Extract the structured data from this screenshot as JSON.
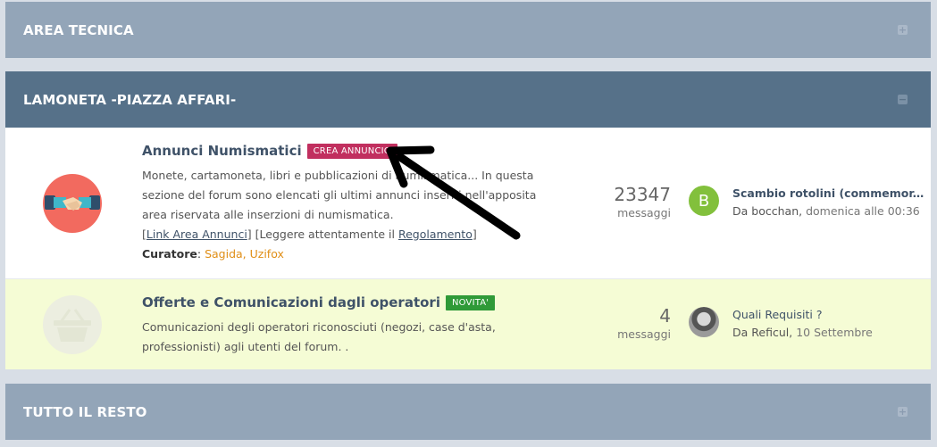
{
  "categories": [
    {
      "title": "AREA TECNICA",
      "state": "collapsed"
    },
    {
      "title": "LAMONETA -PIAZZA AFFARI-",
      "state": "expanded"
    },
    {
      "title": "TUTTO IL RESTO",
      "state": "collapsed"
    }
  ],
  "forums": [
    {
      "title": "Annunci Numismatici",
      "badge": "CREA ANNUNCIO",
      "badge_color": "#c12f5f",
      "desc_line1": "Monete, cartamoneta, libri e pubblicazioni di numismatica... In questa",
      "desc_line2": "sezione del forum sono elencati gli ultimi annunci inseriti nell'apposita",
      "desc_line3": "area riservata alle inserzioni di numismatica.",
      "link_annunci": "Link Area Annunci",
      "leggere": "Leggere attentamente il",
      "regolamento": "Regolamento",
      "curatore_label": "Curatore",
      "curatori": "Sagida, Uzifox",
      "count": "23347",
      "count_label": "messaggi",
      "last_post_title": "Scambio rotolini (commemor...",
      "last_post_by_prefix": "Da",
      "last_post_author": "bocchan,",
      "last_post_date": "domenica alle 00:36",
      "avatar_letter": "B",
      "icon": "handshake-icon"
    },
    {
      "title": "Offerte e Comunicazioni dagli operatori",
      "badge": "NOVITA'",
      "badge_color": "#2f9a38",
      "desc_line1": "Comunicazioni degli operatori riconosciuti (negozi, case d'asta,",
      "desc_line2": "professionisti) agli utenti del forum. .",
      "count": "4",
      "count_label": "messaggi",
      "last_post_title": "Quali Requisiti ?",
      "last_post_by_prefix": "Da",
      "last_post_author": "Reficul,",
      "last_post_date": "10 Settembre",
      "icon": "basket-icon"
    }
  ],
  "colors": {
    "header_collapsed": "#93a5b8",
    "header_expanded": "#567189",
    "highlight_row": "#f5fcd5",
    "moderator": "#e08f17"
  }
}
